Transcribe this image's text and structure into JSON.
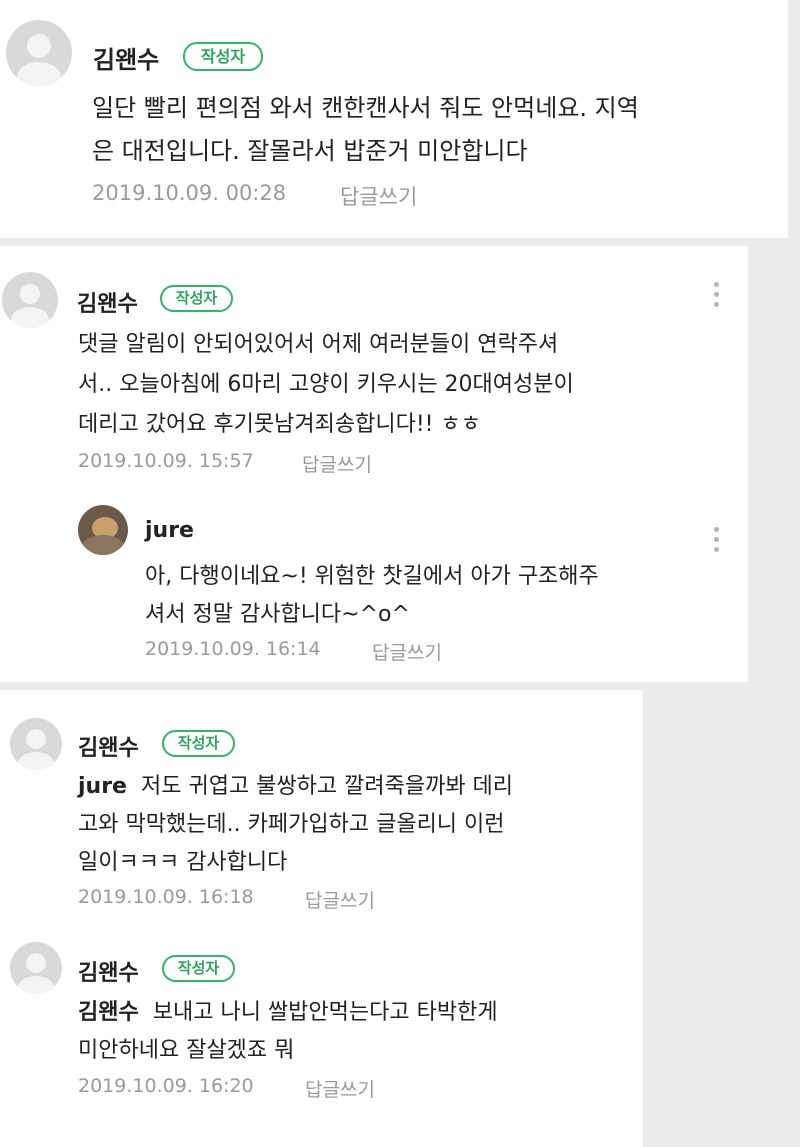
{
  "comments": [
    {
      "author": "김왠수",
      "badge": "작성자",
      "lines": [
        "일단 빨리 편의점 와서 캔한캔사서 줘도 안먹네요. 지역",
        "은 대전입니다. 잘몰라서 밥준거 미안합니다"
      ],
      "date": "2019.10.09. 00:28",
      "reply": "답글쓰기"
    },
    {
      "author": "김왠수",
      "badge": "작성자",
      "lines": [
        "댓글 알림이 안되어있어서 어제 여러분들이 연락주셔",
        "서.. 오늘아침에 6마리 고양이 키우시는 20대여성분이",
        "데리고 갔어요 후기못남겨죄송합니다!! ㅎㅎ"
      ],
      "date": "2019.10.09. 15:57",
      "reply": "답글쓰기"
    },
    {
      "author": "jure",
      "lines": [
        "아, 다행이네요~! 위험한 찻길에서 아가 구조해주",
        "셔서 정말 감사합니다~^o^"
      ],
      "date": "2019.10.09. 16:14",
      "reply": "답글쓰기"
    },
    {
      "author": "김왠수",
      "badge": "작성자",
      "mention": "jure",
      "lines": [
        "저도 귀엽고 불쌍하고 깔려죽을까봐 데리",
        "고와 막막했는데.. 카페가입하고 글올리니 이런",
        "일이ㅋㅋㅋ 감사합니다"
      ],
      "date": "2019.10.09. 16:18",
      "reply": "답글쓰기"
    },
    {
      "author": "김왠수",
      "badge": "작성자",
      "mention": "김왠수",
      "lines": [
        "보내고 나니 쌀밥안먹는다고 타박한게",
        "미안하네요 잘살겠죠 뭐"
      ],
      "date": "2019.10.09. 16:20",
      "reply": "답글쓰기"
    }
  ]
}
